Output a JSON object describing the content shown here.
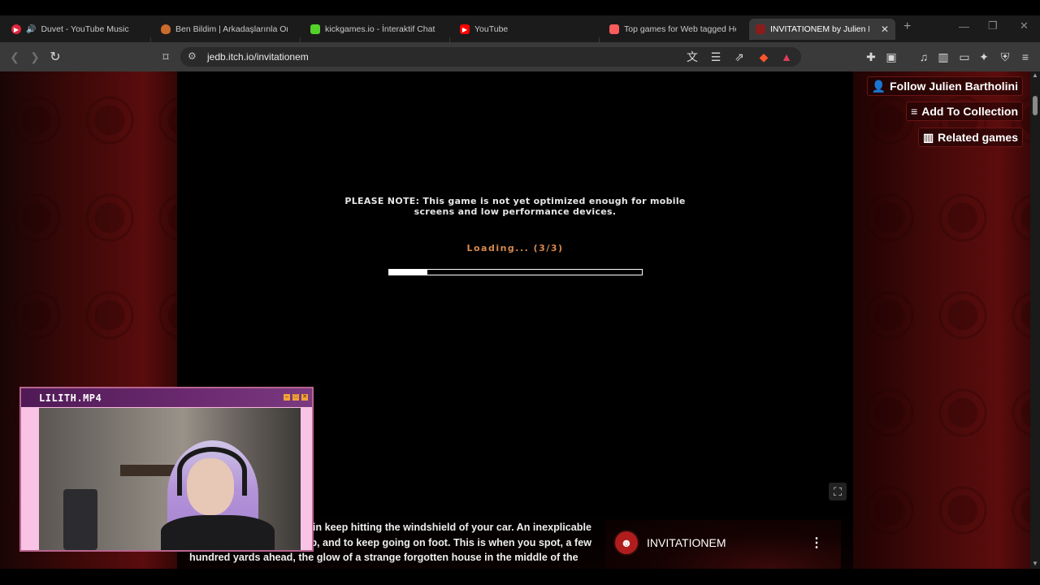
{
  "browser": {
    "tabs": [
      {
        "title": "Duvet - YouTube Music",
        "favicon_color": "#e0263b",
        "has_audio": true
      },
      {
        "title": "Ben Bildim | Arkadaşlarınla Online",
        "favicon_color": "#c96b2c"
      },
      {
        "title": "kickgames.io - İnteraktif Chat Oy",
        "favicon_color": "#53d12a"
      },
      {
        "title": "YouTube",
        "favicon_color": "#ff0000"
      },
      {
        "title": "Top games for Web tagged Horror",
        "favicon_color": "#fa5c5c"
      },
      {
        "title": "INVITATIONEM by Julien Bartholini",
        "favicon_color": "#8a1c1c",
        "active": true
      }
    ],
    "new_tab_label": "+",
    "url": "jedb.itch.io/invitationem"
  },
  "page": {
    "buttons": {
      "follow": "Follow Julien Bartholini",
      "add_collection": "Add To Collection",
      "related": "Related games"
    },
    "game": {
      "note_line1": "PLEASE NOTE: This game is not yet optimized enough for mobile",
      "note_line2": "screens and low performance devices.",
      "loading_text": "Loading... (3/3)",
      "progress_fraction": 0.15
    },
    "description": {
      "line1": "rain keep hitting the windshield of your car. An inexplicable",
      "line2": "top, and to keep going on foot. This is when you spot, a few",
      "line3": "hundred yards ahead, the glow of a strange forgotten house in the middle of the"
    },
    "youtube_card": {
      "title": "INVITATIONEM"
    }
  },
  "webcam": {
    "title": "LILITH.MP4"
  },
  "colors": {
    "loading_accent": "#d6894f",
    "itch_border": "#6b1414",
    "cam_frame": "#f5b6dd",
    "cam_titlebar": "#4f1a55"
  }
}
